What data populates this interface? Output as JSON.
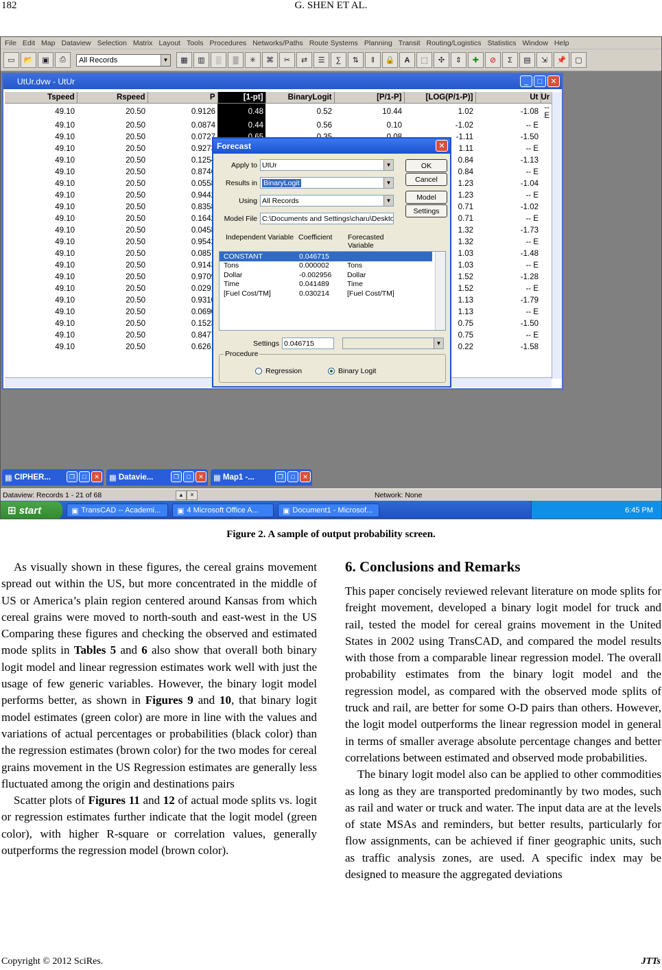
{
  "header": {
    "page_number": "182",
    "running_head": "G. SHEN    ET    AL."
  },
  "screen": {
    "menu": [
      "File",
      "Edit",
      "Map",
      "Dataview",
      "Selection",
      "Matrix",
      "Layout",
      "Tools",
      "Procedures",
      "Networks/Paths",
      "Route Systems",
      "Planning",
      "Transit",
      "Routing/Logistics",
      "Statistics",
      "Window",
      "Help"
    ],
    "toolbar_select": "All Records",
    "dataview": {
      "title": "UtUr.dvw - UtUr",
      "columns": [
        "Tspeed",
        "Rspeed",
        "P",
        "[1-pt]",
        "BinaryLogit",
        "[P/1-P]",
        "[LOG(P/1-P)]",
        "Ut",
        "Ur"
      ],
      "rows": [
        [
          "49.10",
          "20.50",
          "0.9126",
          "0.48",
          "0.52",
          "10.44",
          "1.02",
          "-1.08",
          "-- E"
        ],
        [
          "49.10",
          "20.50",
          "0.0874",
          "0.44",
          "0.56",
          "0.10",
          "-1.02",
          "-- E",
          ""
        ],
        [
          "49.10",
          "20.50",
          "0.0727",
          "0.65",
          "0.35",
          "0.08",
          "-1.11",
          "-1.50",
          ""
        ],
        [
          "49.10",
          "20.50",
          "0.9273",
          "",
          "",
          "",
          "1.11",
          "-- E",
          ""
        ],
        [
          "49.10",
          "20.50",
          "0.1254",
          "",
          "",
          "",
          "0.84",
          "-1.13",
          ""
        ],
        [
          "49.10",
          "20.50",
          "0.8746",
          "",
          "",
          "",
          "0.84",
          "-- E",
          ""
        ],
        [
          "49.10",
          "20.50",
          "0.0558",
          "",
          "",
          "",
          "1.23",
          "-1.04",
          ""
        ],
        [
          "49.10",
          "20.50",
          "0.9442",
          "",
          "",
          "",
          "1.23",
          "-- E",
          ""
        ],
        [
          "49.10",
          "20.50",
          "0.8358",
          "",
          "",
          "",
          "0.71",
          "-1.02",
          ""
        ],
        [
          "49.10",
          "20.50",
          "0.1642",
          "",
          "",
          "",
          "0.71",
          "-- E",
          ""
        ],
        [
          "49.10",
          "20.50",
          "0.0458",
          "",
          "",
          "",
          "1.32",
          "-1.73",
          ""
        ],
        [
          "49.10",
          "20.50",
          "0.9542",
          "",
          "",
          "",
          "1.32",
          "-- E",
          ""
        ],
        [
          "49.10",
          "20.50",
          "0.0857",
          "",
          "",
          "",
          "1.03",
          "-1.48",
          ""
        ],
        [
          "49.10",
          "20.50",
          "0.9143",
          "",
          "",
          "",
          "1.03",
          "-- E",
          ""
        ],
        [
          "49.10",
          "20.50",
          "0.9709",
          "",
          "",
          "",
          "1.52",
          "-1.28",
          ""
        ],
        [
          "49.10",
          "20.50",
          "0.0291",
          "",
          "",
          "",
          "1.52",
          "-- E",
          ""
        ],
        [
          "49.10",
          "20.50",
          "0.9310",
          "",
          "",
          "",
          "1.13",
          "-1.79",
          ""
        ],
        [
          "49.10",
          "20.50",
          "0.0690",
          "",
          "",
          "",
          "1.13",
          "-- E",
          ""
        ],
        [
          "49.10",
          "20.50",
          "0.1523",
          "",
          "",
          "",
          "0.75",
          "-1.50",
          ""
        ],
        [
          "49.10",
          "20.50",
          "0.8477",
          "",
          "",
          "",
          "0.75",
          "-- E",
          ""
        ],
        [
          "49.10",
          "20.50",
          "0.6261",
          "",
          "",
          "",
          "0.22",
          "-1.58",
          ""
        ]
      ]
    },
    "forecast": {
      "title": "Forecast",
      "apply_label": "Apply to",
      "apply_value": "UtUr",
      "results_label": "Results in",
      "results_value": "BinaryLogit",
      "using_label": "Using",
      "using_value": "All Records",
      "modelfile_label": "Model File",
      "modelfile_value": "C:\\Documents and Settings\\charu\\Deskto",
      "ok": "OK",
      "cancel": "Cancel",
      "model": "Model",
      "settings_btn": "Settings",
      "head_indep": "Independent Variable",
      "head_coef": "Coefficient",
      "head_fore": "Forecasted Variable",
      "list": [
        {
          "var": "CONSTANT",
          "coef": "0.046715",
          "fore": ""
        },
        {
          "var": "Tons",
          "coef": "0.000002",
          "fore": "Tons"
        },
        {
          "var": "Dollar",
          "coef": "-0.002956",
          "fore": "Dollar"
        },
        {
          "var": "Time",
          "coef": "0.041489",
          "fore": "Time"
        },
        {
          "var": "[Fuel Cost/TM]",
          "coef": "0.030214",
          "fore": "[Fuel Cost/TM]"
        }
      ],
      "settings_label": "Settings",
      "settings_value": "0.046715",
      "procedure_label": "Procedure",
      "radio1": "Regression",
      "radio2": "Binary Logit"
    },
    "min_windows": [
      "CIPHER...",
      "Datavie...",
      "Map1 -..."
    ],
    "status_left": "Dataview: Records 1 - 21 of 68",
    "status_right": "Network: None",
    "start": "start",
    "tasks": [
      "TransCAD -- Academi...",
      "4 Microsoft Office A...",
      "Document1 - Microsof..."
    ],
    "clock": "6:45 PM"
  },
  "caption": "Figure 2. A sample of output probability screen.",
  "left_col": {
    "p1_a": "As visually shown in these figures, the cereal grains movement spread out within the US, but more concentrated in the middle of US or America’s plain region centered around Kansas from which cereal grains were moved to north-south and east-west in the US Comparing these figures and checking the observed and estimated mode splits in ",
    "p1_t5": "Tables 5",
    "p1_b": " and ",
    "p1_t6": "6",
    "p1_c": " also show that overall both binary logit model and linear regression estimates work well with just the usage of few generic variables. However, the binary logit model performs better, as shown in ",
    "p1_f9": "Figures 9",
    "p1_d": " and ",
    "p1_f10": "10",
    "p1_e": ", that binary logit model estimates (green color) are more in line with the values and variations of actual percentages or probabilities (black color) than the regression estimates (brown color) for the two modes for cereal grains movement in the US Regression estimates are generally less fluctuated among the origin and destinations pairs",
    "p2_a": "Scatter plots of ",
    "p2_f11": "Figures 11",
    "p2_b": " and ",
    "p2_f12": "12",
    "p2_c": " of actual mode splits vs. logit or regression estimates further indicate that the logit model (green color), with higher R-square or correlation values, generally outperforms the regression model (brown color)."
  },
  "right_col": {
    "heading": "6. Conclusions and Remarks",
    "p1": "This paper concisely reviewed relevant literature on mode splits for freight movement, developed a binary logit model for truck and rail, tested the model for cereal grains movement in the United States in 2002 using TransCAD, and compared the model results with those from a comparable linear regression model. The overall probability estimates from the binary logit model and the regression model, as compared with the observed mode splits of truck and rail, are better for some O-D pairs than others. However, the logit model outperforms the linear regression model in general in terms of smaller average absolute percentage changes and better correlations between estimated and observed mode probabilities.",
    "p2": "The binary logit model also can be applied to other commodities as long as they are transported predominantly by two modes, such as rail and water or truck and water. The input data are at the levels of state MSAs and reminders, but better results, particularly for flow assignments, can be achieved if finer geographic units, such as traffic analysis zones, are used. A specific index may be designed to measure the aggregated deviations"
  },
  "footer": {
    "copyright": "Copyright © 2012 SciRes.",
    "journal": "JTTs"
  }
}
